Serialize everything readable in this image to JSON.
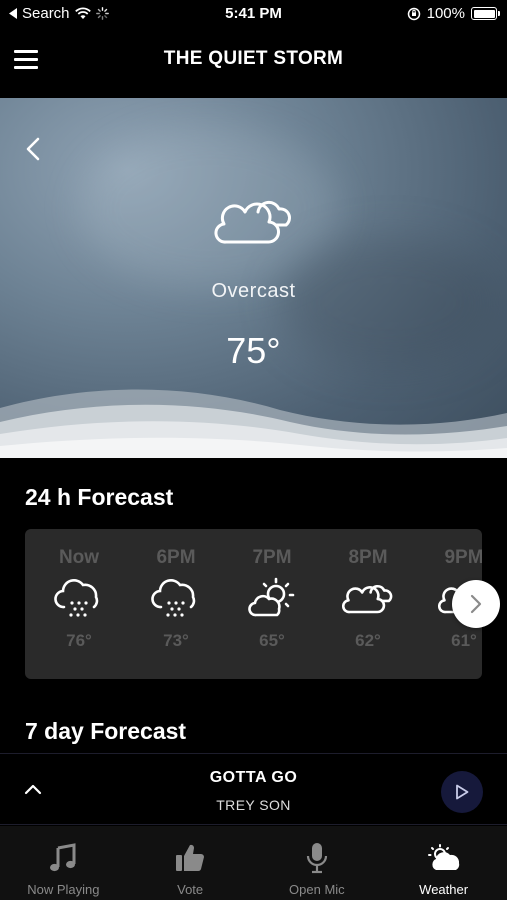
{
  "status_bar": {
    "back_label": "Search",
    "time": "5:41 PM",
    "battery": "100%"
  },
  "header": {
    "title": "THE QUIET STORM"
  },
  "current": {
    "condition": "Overcast",
    "temperature": "75°",
    "icon": "cloudy-icon"
  },
  "forecast_24h": {
    "title": "24 h Forecast",
    "hours": [
      {
        "label": "Now",
        "temp": "76°",
        "icon": "rain-icon"
      },
      {
        "label": "6PM",
        "temp": "73°",
        "icon": "rain-icon"
      },
      {
        "label": "7PM",
        "temp": "65°",
        "icon": "partly-sunny-icon"
      },
      {
        "label": "8PM",
        "temp": "62°",
        "icon": "cloudy-icon"
      },
      {
        "label": "9PM",
        "temp": "61°",
        "icon": "cloudy-icon"
      }
    ]
  },
  "forecast_7day": {
    "title": "7 day Forecast"
  },
  "player": {
    "song": "GOTTA GO",
    "artist": "TREY SON"
  },
  "tabs": [
    {
      "label": "Now Playing",
      "icon": "music-note-icon"
    },
    {
      "label": "Vote",
      "icon": "thumbs-up-icon"
    },
    {
      "label": "Open Mic",
      "icon": "microphone-icon"
    },
    {
      "label": "Weather",
      "icon": "weather-icon",
      "active": true
    }
  ],
  "colors": {
    "background": "#000000",
    "card": "#2a2a2a",
    "muted_text": "#5a5a5a",
    "play_button": "#16193b"
  }
}
